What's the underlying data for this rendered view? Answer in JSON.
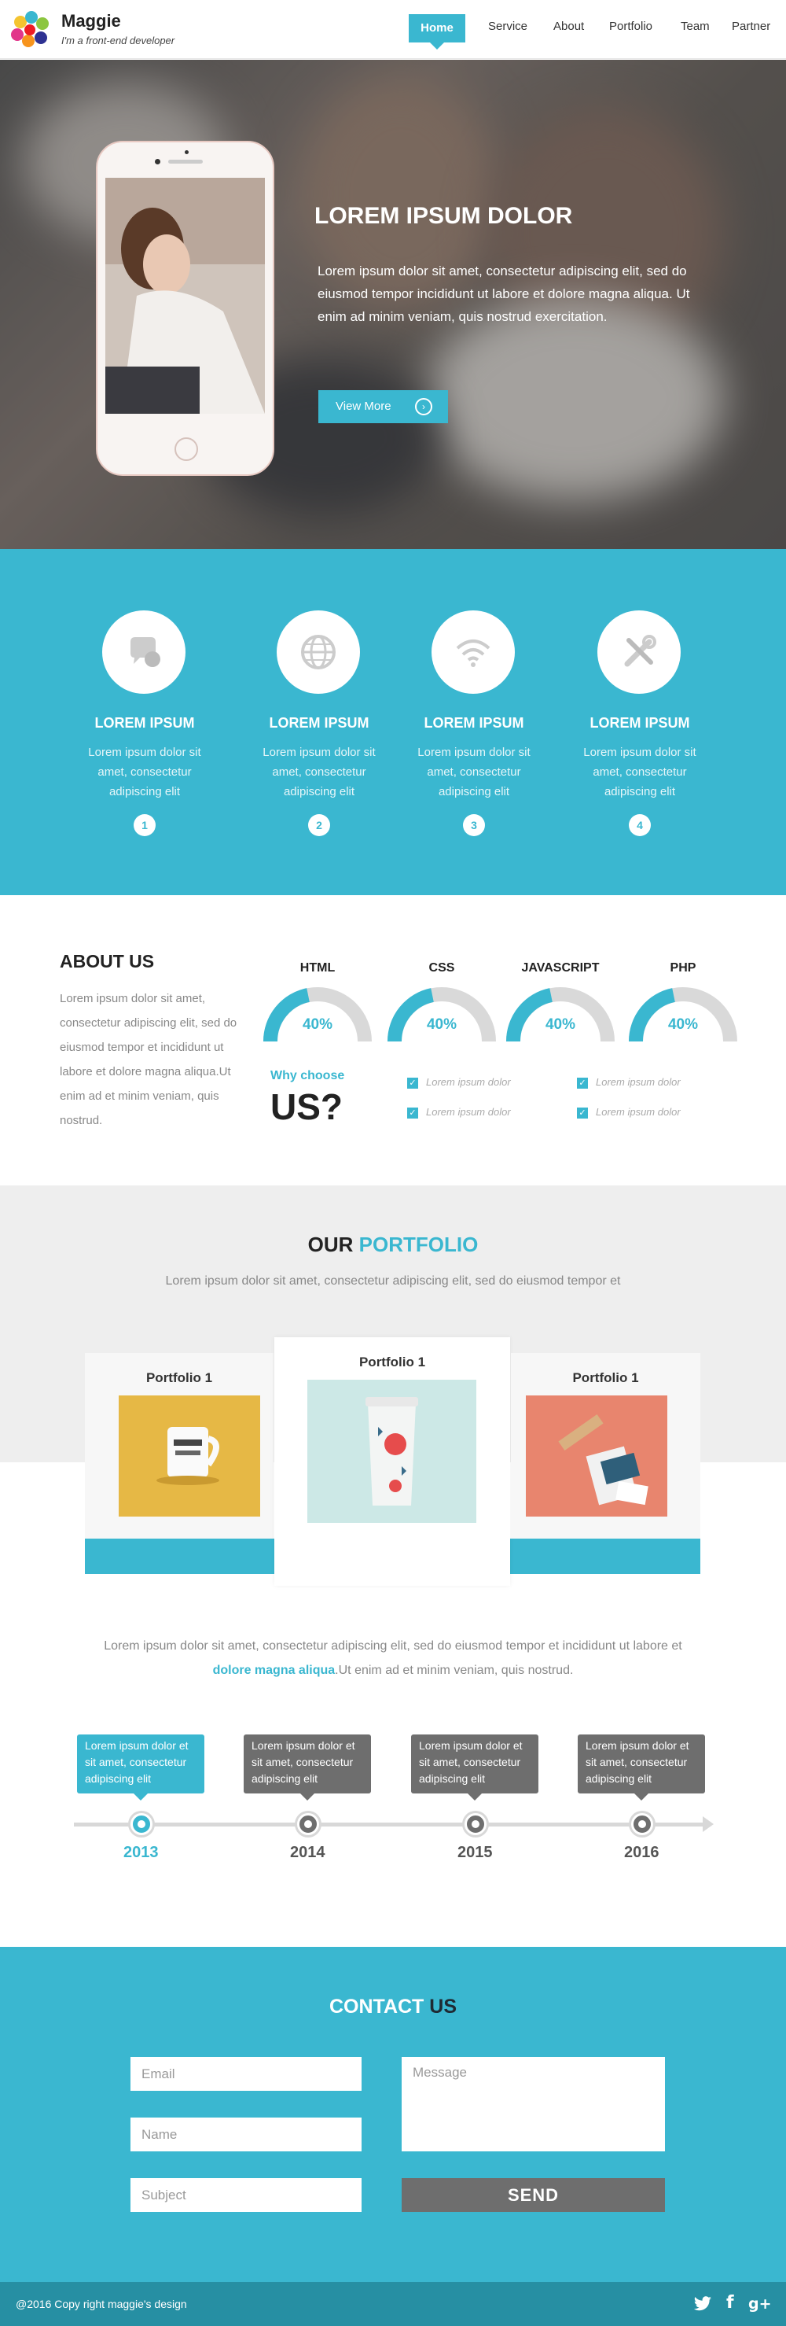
{
  "header": {
    "brand": "Maggie",
    "tagline": "I'm a front-end developer",
    "nav": [
      "Home",
      "Service",
      "About",
      "Portfolio",
      "Team",
      "Partner"
    ]
  },
  "hero": {
    "title": "LOREM IPSUM DOLOR",
    "text": "Lorem ipsum dolor sit amet, consectetur adipiscing elit, sed do eiusmod tempor incididunt ut labore et dolore magna aliqua. Ut enim ad minim veniam, quis nostrud exercitation.",
    "button": "View More"
  },
  "services": [
    {
      "title": "LOREM IPSUM",
      "text": "Lorem ipsum dolor sit amet, consectetur adipiscing elit",
      "num": "1",
      "icon": "chat-icon"
    },
    {
      "title": "LOREM IPSUM",
      "text": "Lorem ipsum dolor sit amet, consectetur adipiscing elit",
      "num": "2",
      "icon": "globe-icon"
    },
    {
      "title": "LOREM IPSUM",
      "text": "Lorem ipsum dolor sit amet, consectetur adipiscing elit",
      "num": "3",
      "icon": "wifi-icon"
    },
    {
      "title": "LOREM IPSUM",
      "text": "Lorem ipsum dolor sit amet, consectetur adipiscing elit",
      "num": "4",
      "icon": "tools-icon"
    }
  ],
  "about": {
    "title": "ABOUT US",
    "text": "Lorem ipsum dolor sit amet, consectetur adipiscing elit, sed do eiusmod tempor et incididunt ut labore et dolore magna aliqua.Ut enim ad et minim veniam, quis nostrud.",
    "skills": [
      {
        "name": "HTML",
        "value": "40%"
      },
      {
        "name": "CSS",
        "value": "40%"
      },
      {
        "name": "JAVASCRIPT",
        "value": "40%"
      },
      {
        "name": "PHP",
        "value": "40%"
      }
    ],
    "why_small": "Why choose",
    "why_big": "US?",
    "checks": [
      "Lorem ipsum dolor",
      "Lorem ipsum dolor",
      "Lorem ipsum dolor",
      "Lorem ipsum dolor"
    ]
  },
  "portfolio": {
    "title_a": "OUR",
    "title_b": "PORTFOLIO",
    "subtitle": "Lorem ipsum dolor sit amet, consectetur adipiscing elit, sed do eiusmod tempor et",
    "cards": [
      "Portfolio 1",
      "Portfolio 1",
      "Portfolio 1"
    ],
    "desc_a": "Lorem ipsum dolor sit amet, consectetur adipiscing elit, sed do eiusmod tempor et incididunt ut labore et ",
    "desc_b": "dolore magna aliqua",
    "desc_c": ".Ut enim ad et minim veniam, quis nostrud."
  },
  "timeline": [
    {
      "text": "Lorem ipsum dolor et sit amet, consectetur adipiscing elit",
      "year": "2013",
      "active": true
    },
    {
      "text": "Lorem ipsum dolor et sit amet, consectetur adipiscing elit",
      "year": "2014",
      "active": false
    },
    {
      "text": "Lorem ipsum dolor et sit amet, consectetur adipiscing elit",
      "year": "2015",
      "active": false
    },
    {
      "text": "Lorem ipsum dolor et sit amet, consectetur adipiscing elit",
      "year": "2016",
      "active": false
    }
  ],
  "contact": {
    "title_a": "CONTACT",
    "title_b": "US",
    "email_placeholder": "Email",
    "name_placeholder": "Name",
    "subject_placeholder": "Subject",
    "message_placeholder": "Message",
    "send": "SEND"
  },
  "footer": {
    "copyright": "@2016 Copy right maggie's design"
  },
  "colors": {
    "accent": "#3ab7d0",
    "dark_accent": "#268fa3",
    "gray_button": "#6e6e6e"
  }
}
